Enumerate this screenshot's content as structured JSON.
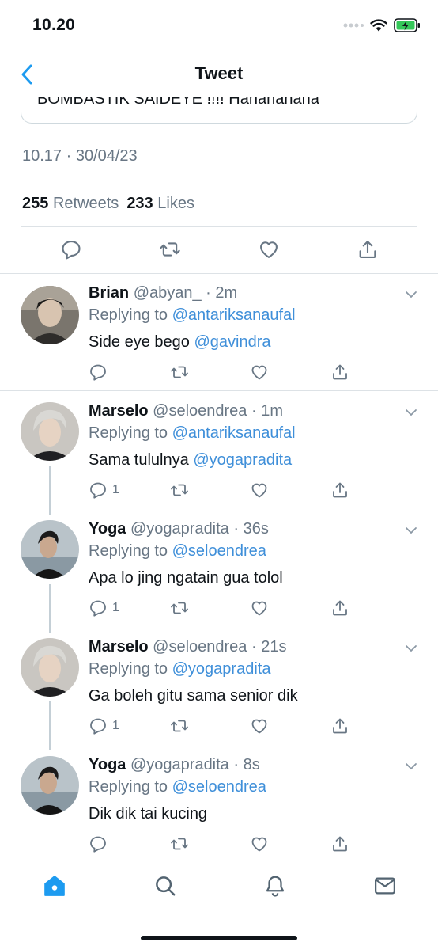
{
  "status_bar": {
    "time": "10.20"
  },
  "nav": {
    "title": "Tweet"
  },
  "main_tweet": {
    "quoted_text": "BOMBASTIK SAIDEYE !!!! Hahahahaha",
    "timestamp": "10.17 · 30/04/23",
    "retweets_count": "255",
    "retweets_label": "Retweets",
    "likes_count": "233",
    "likes_label": "Likes"
  },
  "replies": [
    {
      "name": "Brian",
      "meta": "@abyan_ · 2m",
      "replying_label": "Replying to",
      "replying_to": "@antariksanaufal",
      "text": "Side eye bego",
      "mention": "@gavindra",
      "reply_count": ""
    },
    {
      "name": "Marselo",
      "meta": "@seloendrea · 1m",
      "replying_label": "Replying to",
      "replying_to": "@antariksanaufal",
      "text": "Sama tululnya",
      "mention": "@yogapradita",
      "reply_count": "1"
    },
    {
      "name": "Yoga",
      "meta": "@yogapradita · 36s",
      "replying_label": "Replying to",
      "replying_to": "@seloendrea",
      "text": "Apa lo jing ngatain gua tolol",
      "mention": "",
      "reply_count": "1"
    },
    {
      "name": "Marselo",
      "meta": "@seloendrea · 21s",
      "replying_label": "Replying to",
      "replying_to": "@yogapradita",
      "text": "Ga boleh gitu sama senior dik",
      "mention": "",
      "reply_count": "1"
    },
    {
      "name": "Yoga",
      "meta": "@yogapradita · 8s",
      "replying_label": "Replying to",
      "replying_to": "@seloendrea",
      "text": "Dik dik tai kucing",
      "mention": "",
      "reply_count": ""
    }
  ],
  "tabbar": {
    "items": [
      "home-icon",
      "search-icon",
      "notifications-icon",
      "messages-icon"
    ]
  },
  "colors": {
    "accent": "#1d9bf0",
    "link": "#3f8fd9",
    "muted": "#687684"
  }
}
